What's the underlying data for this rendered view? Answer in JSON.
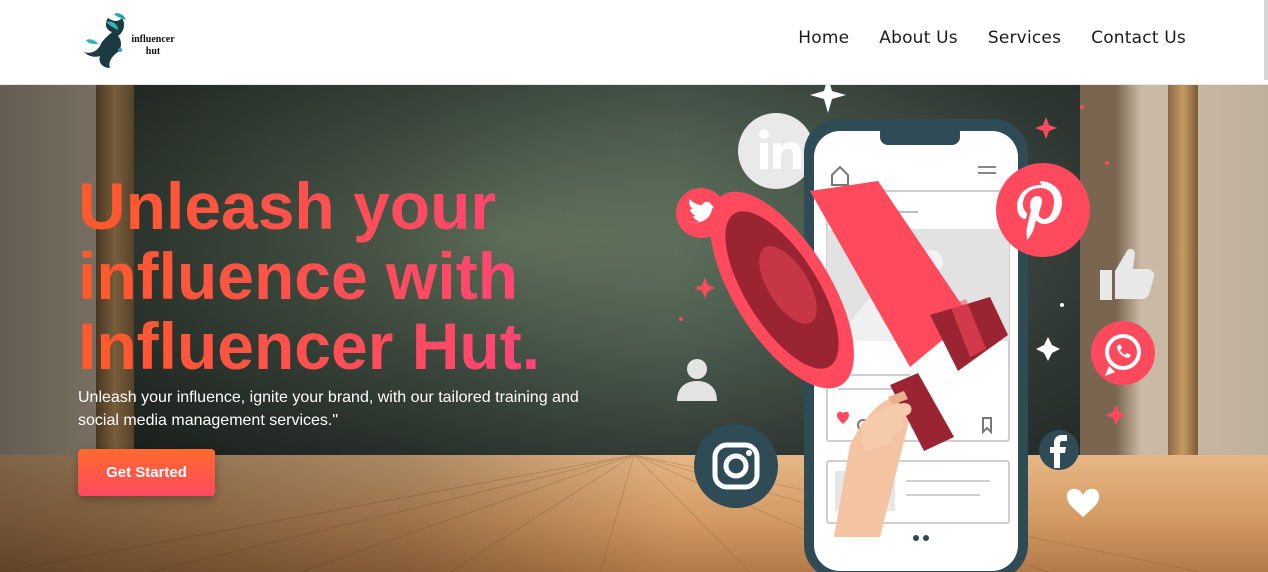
{
  "header": {
    "logo_text": "influencer hut",
    "nav": [
      {
        "label": "Home"
      },
      {
        "label": "About Us"
      },
      {
        "label": "Services"
      },
      {
        "label": "Contact Us"
      }
    ]
  },
  "hero": {
    "headline": "Unleash your influence with Influencer Hut.",
    "subtitle": "Unleash your influence, ignite your brand, with our tailored training and social media management services.\"",
    "cta_label": "Get Started"
  },
  "icons": [
    "linkedin-icon",
    "twitter-icon",
    "pinterest-icon",
    "thumbs-up-icon",
    "whatsapp-icon",
    "user-icon",
    "instagram-icon",
    "facebook-icon",
    "heart-icon",
    "megaphone-icon",
    "smartphone-icon"
  ],
  "colors": {
    "accent_orange": "#ff5a2a",
    "accent_pink": "#ff3e88",
    "brand_red": "#ff4a5e",
    "dark_teal": "#2f4b55"
  }
}
